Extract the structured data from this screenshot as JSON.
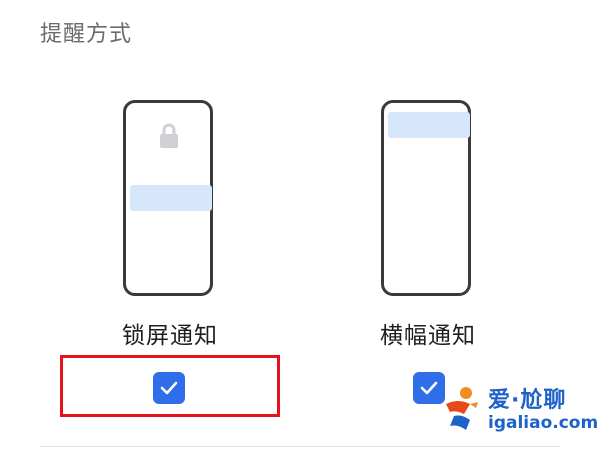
{
  "section": {
    "title": "提醒方式"
  },
  "options": {
    "lockscreen": {
      "label": "锁屏通知",
      "checked": true
    },
    "banner": {
      "label": "横幅通知",
      "checked": true
    }
  },
  "watermark": {
    "brand": "爱·尬聊",
    "url": "igaliao.com"
  },
  "colors": {
    "accent": "#2f6ee8",
    "preview_card": "#d6e6fb",
    "highlight": "#e3121c",
    "watermark": "#1e62c9"
  },
  "icons": {
    "lock": "lock-icon",
    "check": "check-icon"
  }
}
